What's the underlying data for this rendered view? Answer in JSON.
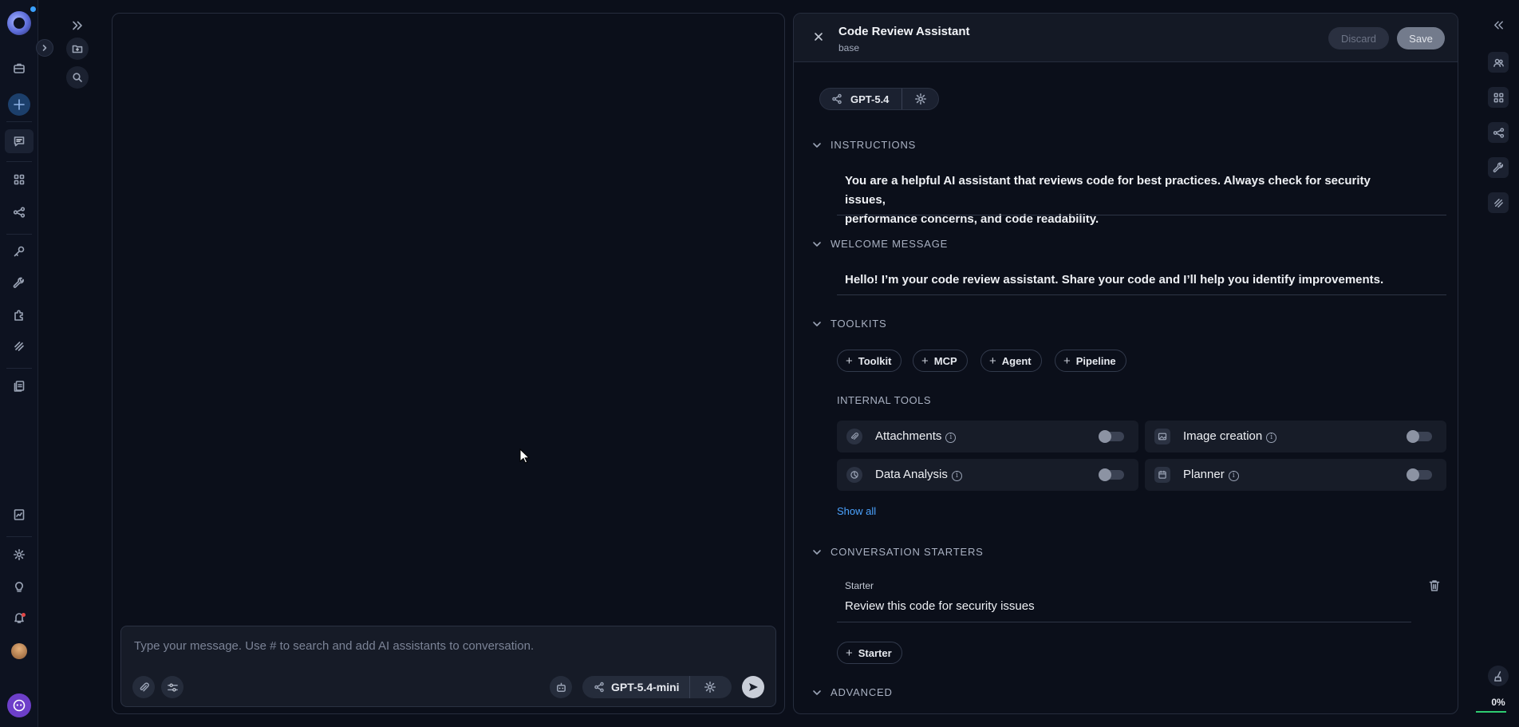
{
  "composer": {
    "placeholder": "Type your message. Use # to search and add AI assistants to conversation.",
    "model": "GPT-5.4-mini"
  },
  "editor": {
    "title": "Code Review Assistant",
    "subtitle": "base",
    "discard_label": "Discard",
    "save_label": "Save",
    "model": "GPT-5.4",
    "sections": {
      "instructions": {
        "heading": "INSTRUCTIONS",
        "text_line1": "You are a helpful AI assistant that reviews code for best practices. Always check for security issues,",
        "text_line2": "performance concerns, and code readability."
      },
      "welcome": {
        "heading": "WELCOME MESSAGE",
        "text": "Hello! I’m your code review assistant. Share your code and I’ll help you identify improvements."
      },
      "toolkits": {
        "heading": "TOOLKITS",
        "add_buttons": [
          "Toolkit",
          "MCP",
          "Agent",
          "Pipeline"
        ],
        "internal_tools_heading": "INTERNAL TOOLS",
        "internal_tools": [
          {
            "label": "Attachments",
            "enabled": false
          },
          {
            "label": "Image creation",
            "enabled": false
          },
          {
            "label": "Data Analysis",
            "enabled": false
          },
          {
            "label": "Planner",
            "enabled": false
          }
        ],
        "show_all_label": "Show all"
      },
      "starters": {
        "heading": "CONVERSATION STARTERS",
        "items": [
          {
            "label": "Starter",
            "text": "Review this code for security issues"
          }
        ],
        "add_label": "Starter"
      },
      "advanced": {
        "heading": "ADVANCED"
      }
    }
  },
  "right_rail": {
    "progress_label": "0%",
    "progress": 0
  },
  "colors": {
    "background": "#0b0f1a",
    "accent_link": "#4ba3ff",
    "progress_bar": "#2ecc71",
    "bot_button": "#6d3fc9"
  }
}
